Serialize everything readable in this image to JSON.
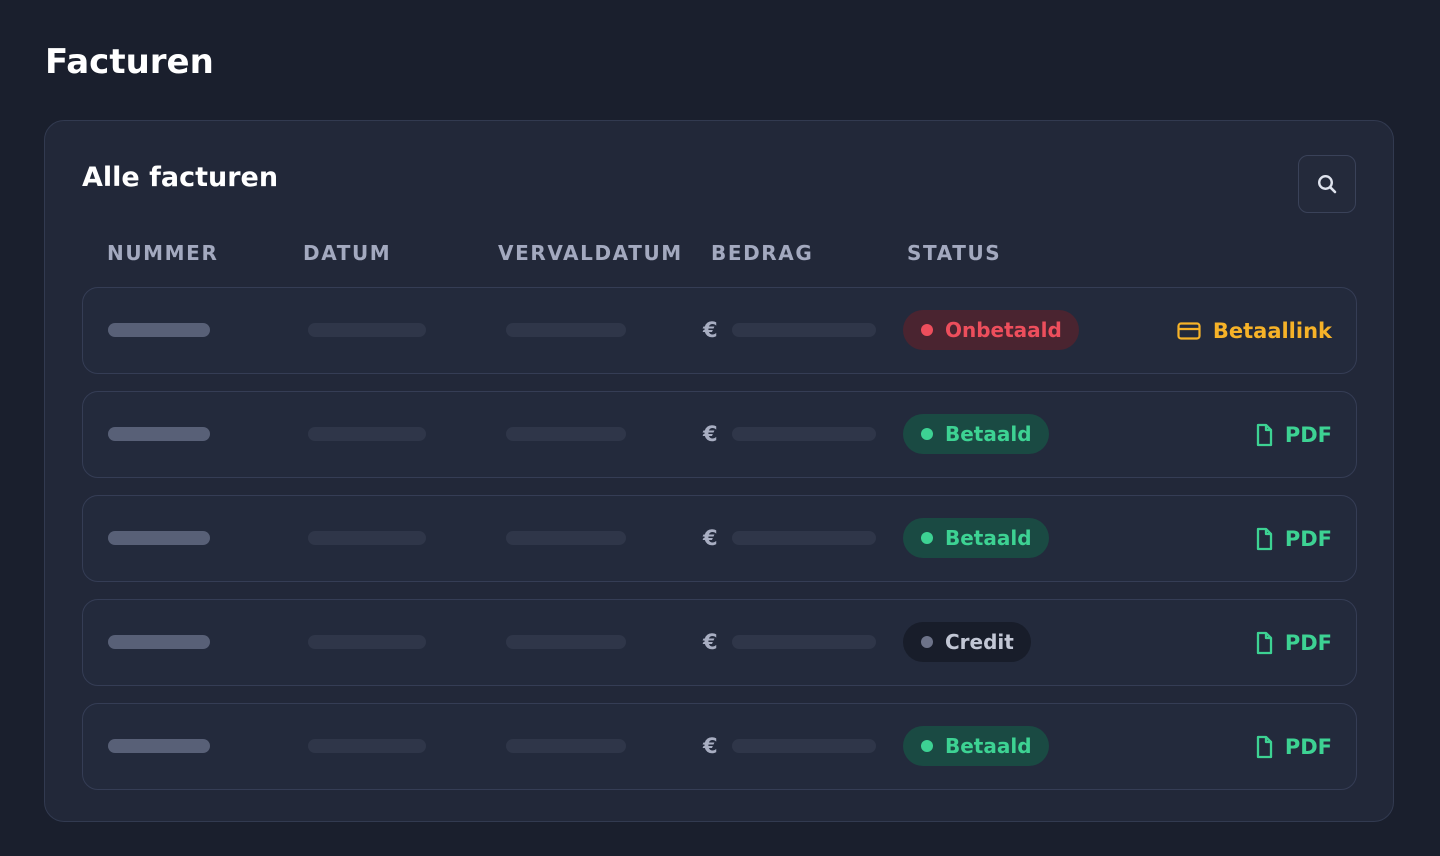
{
  "page": {
    "title": "Facturen"
  },
  "card": {
    "title": "Alle facturen",
    "search_icon": "search-icon"
  },
  "table": {
    "columns": [
      "NUMMER",
      "DATUM",
      "VERVALDATUM",
      "BEDRAG",
      "STATUS"
    ],
    "currency_symbol": "€",
    "rows": [
      {
        "status": "Onbetaald",
        "status_type": "unpaid",
        "action_label": "Betaallink",
        "action_icon": "credit-card-icon"
      },
      {
        "status": "Betaald",
        "status_type": "paid",
        "action_label": "PDF",
        "action_icon": "document-icon"
      },
      {
        "status": "Betaald",
        "status_type": "paid",
        "action_label": "PDF",
        "action_icon": "document-icon"
      },
      {
        "status": "Credit",
        "status_type": "credit",
        "action_label": "PDF",
        "action_icon": "document-icon"
      },
      {
        "status": "Betaald",
        "status_type": "paid",
        "action_label": "PDF",
        "action_icon": "document-icon"
      }
    ]
  },
  "colors": {
    "background": "#1a1f2d",
    "card": "#222839",
    "unpaid": "#ed4e5c",
    "paid": "#3dd293",
    "paylink": "#f6b228",
    "credit_text": "#c2c7d5"
  }
}
